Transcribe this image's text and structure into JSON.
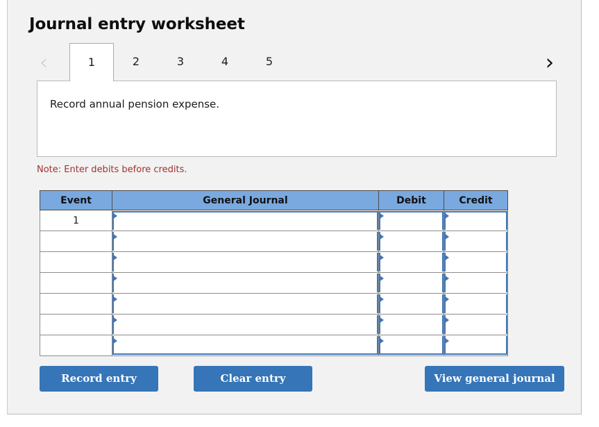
{
  "page_title": "Journal entry worksheet",
  "tabs": {
    "prev_arrow_icon": "chevron-left-icon",
    "next_arrow_icon": "chevron-right-icon",
    "items": [
      {
        "label": "1",
        "active": true
      },
      {
        "label": "2",
        "active": false
      },
      {
        "label": "3",
        "active": false
      },
      {
        "label": "4",
        "active": false
      },
      {
        "label": "5",
        "active": false
      }
    ]
  },
  "description": {
    "text": "Record annual pension expense."
  },
  "note": {
    "text": "Note: Enter debits before credits.",
    "color": "#a33131"
  },
  "table": {
    "headers": {
      "event": "Event",
      "general_journal": "General Journal",
      "debit": "Debit",
      "credit": "Credit"
    },
    "header_bg": "#7aa9e0",
    "input_border_color": "#4276b4",
    "rows": [
      {
        "event": "1",
        "general_journal": "",
        "debit": "",
        "credit": ""
      },
      {
        "event": "",
        "general_journal": "",
        "debit": "",
        "credit": ""
      },
      {
        "event": "",
        "general_journal": "",
        "debit": "",
        "credit": ""
      },
      {
        "event": "",
        "general_journal": "",
        "debit": "",
        "credit": ""
      },
      {
        "event": "",
        "general_journal": "",
        "debit": "",
        "credit": ""
      },
      {
        "event": "",
        "general_journal": "",
        "debit": "",
        "credit": ""
      },
      {
        "event": "",
        "general_journal": "",
        "debit": "",
        "credit": ""
      }
    ]
  },
  "buttons": {
    "record_entry": "Record entry",
    "clear_entry": "Clear entry",
    "view_general_journal": "View general journal",
    "color": "#3575b8"
  }
}
